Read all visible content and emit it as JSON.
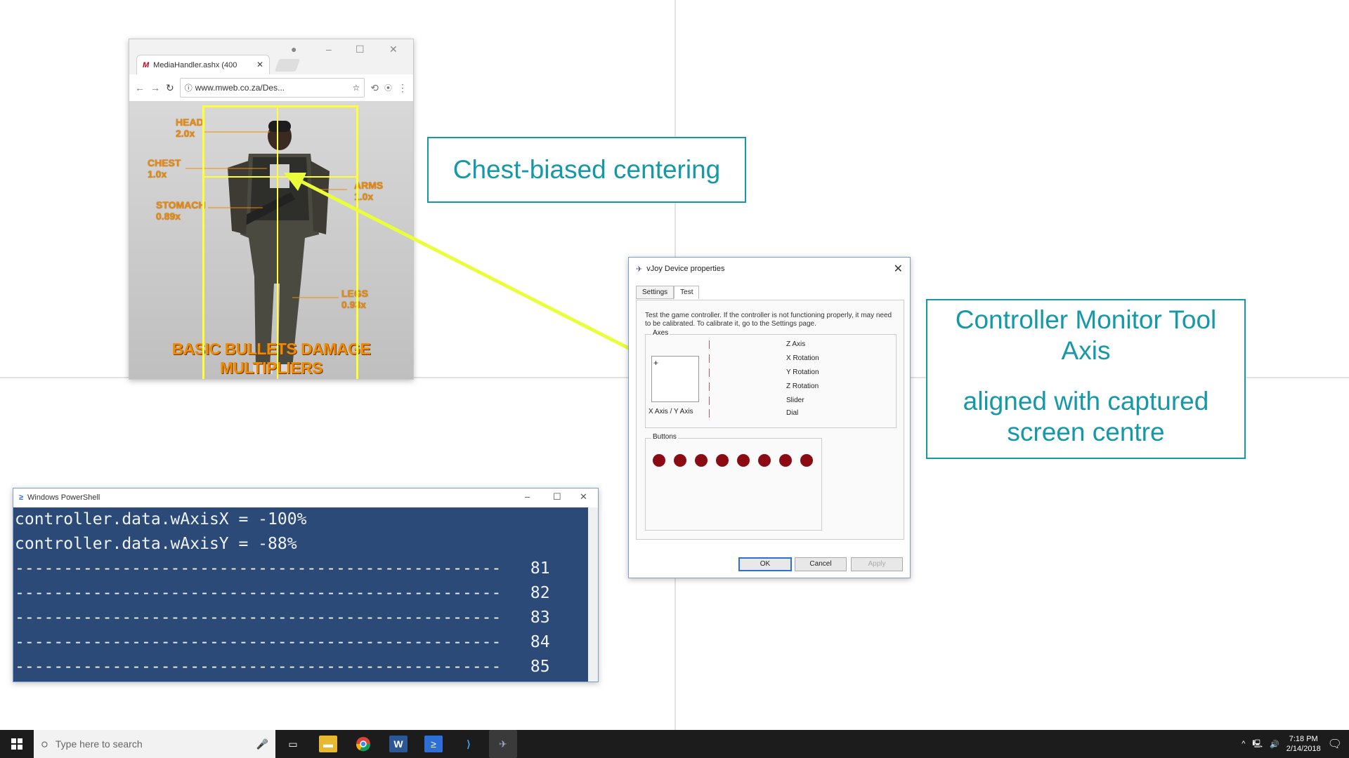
{
  "browser": {
    "tab_title": "MediaHandler.ashx (400",
    "tab_favicon": "M",
    "url": "www.mweb.co.za/Des...",
    "image": {
      "labels": [
        {
          "name": "HEAD",
          "mult": "2.0x"
        },
        {
          "name": "CHEST",
          "mult": "1.0x"
        },
        {
          "name": "STOMACH",
          "mult": "0.89x"
        },
        {
          "name": "ARMS",
          "mult": "1.0x"
        },
        {
          "name": "LEGS",
          "mult": "0.93x"
        }
      ],
      "title": "BASIC BULLETS DAMAGE MULTIPLIERS"
    }
  },
  "callouts": {
    "chest": "Chest-biased centering",
    "controller_line1": "Controller Monitor Tool",
    "controller_line2": "Axis",
    "controller_line3": "aligned with captured",
    "controller_line4": "screen centre"
  },
  "dialog": {
    "title": "vJoy Device properties",
    "tabs": [
      "Settings",
      "Test"
    ],
    "description": "Test the game controller.  If the controller is not functioning properly, it may need to be calibrated.  To calibrate it, go to the Settings page.",
    "axes_group": "Axes",
    "axes_xy_label": "X Axis / Y Axis",
    "axes": [
      "Z Axis",
      "X Rotation",
      "Y Rotation",
      "Z Rotation",
      "Slider",
      "Dial"
    ],
    "buttons_group": "Buttons",
    "button_count": 8,
    "ok": "OK",
    "cancel": "Cancel",
    "apply": "Apply"
  },
  "powershell": {
    "title": "Windows PowerShell",
    "lines": [
      "controller.data.wAxisX = -100%",
      "controller.data.wAxisY = -88%",
      "--------------------------------------------------   81",
      "--------------------------------------------------   82",
      "--------------------------------------------------   83",
      "--------------------------------------------------   84",
      "--------------------------------------------------   85"
    ]
  },
  "taskbar": {
    "search_placeholder": "Type here to search",
    "time": "7:18 PM",
    "date": "2/14/2018"
  },
  "colors": {
    "callout": "#1598a8",
    "highlight": "#ffff33",
    "ps_bg": "#2c4a78",
    "damage_label": "#f28a00"
  }
}
